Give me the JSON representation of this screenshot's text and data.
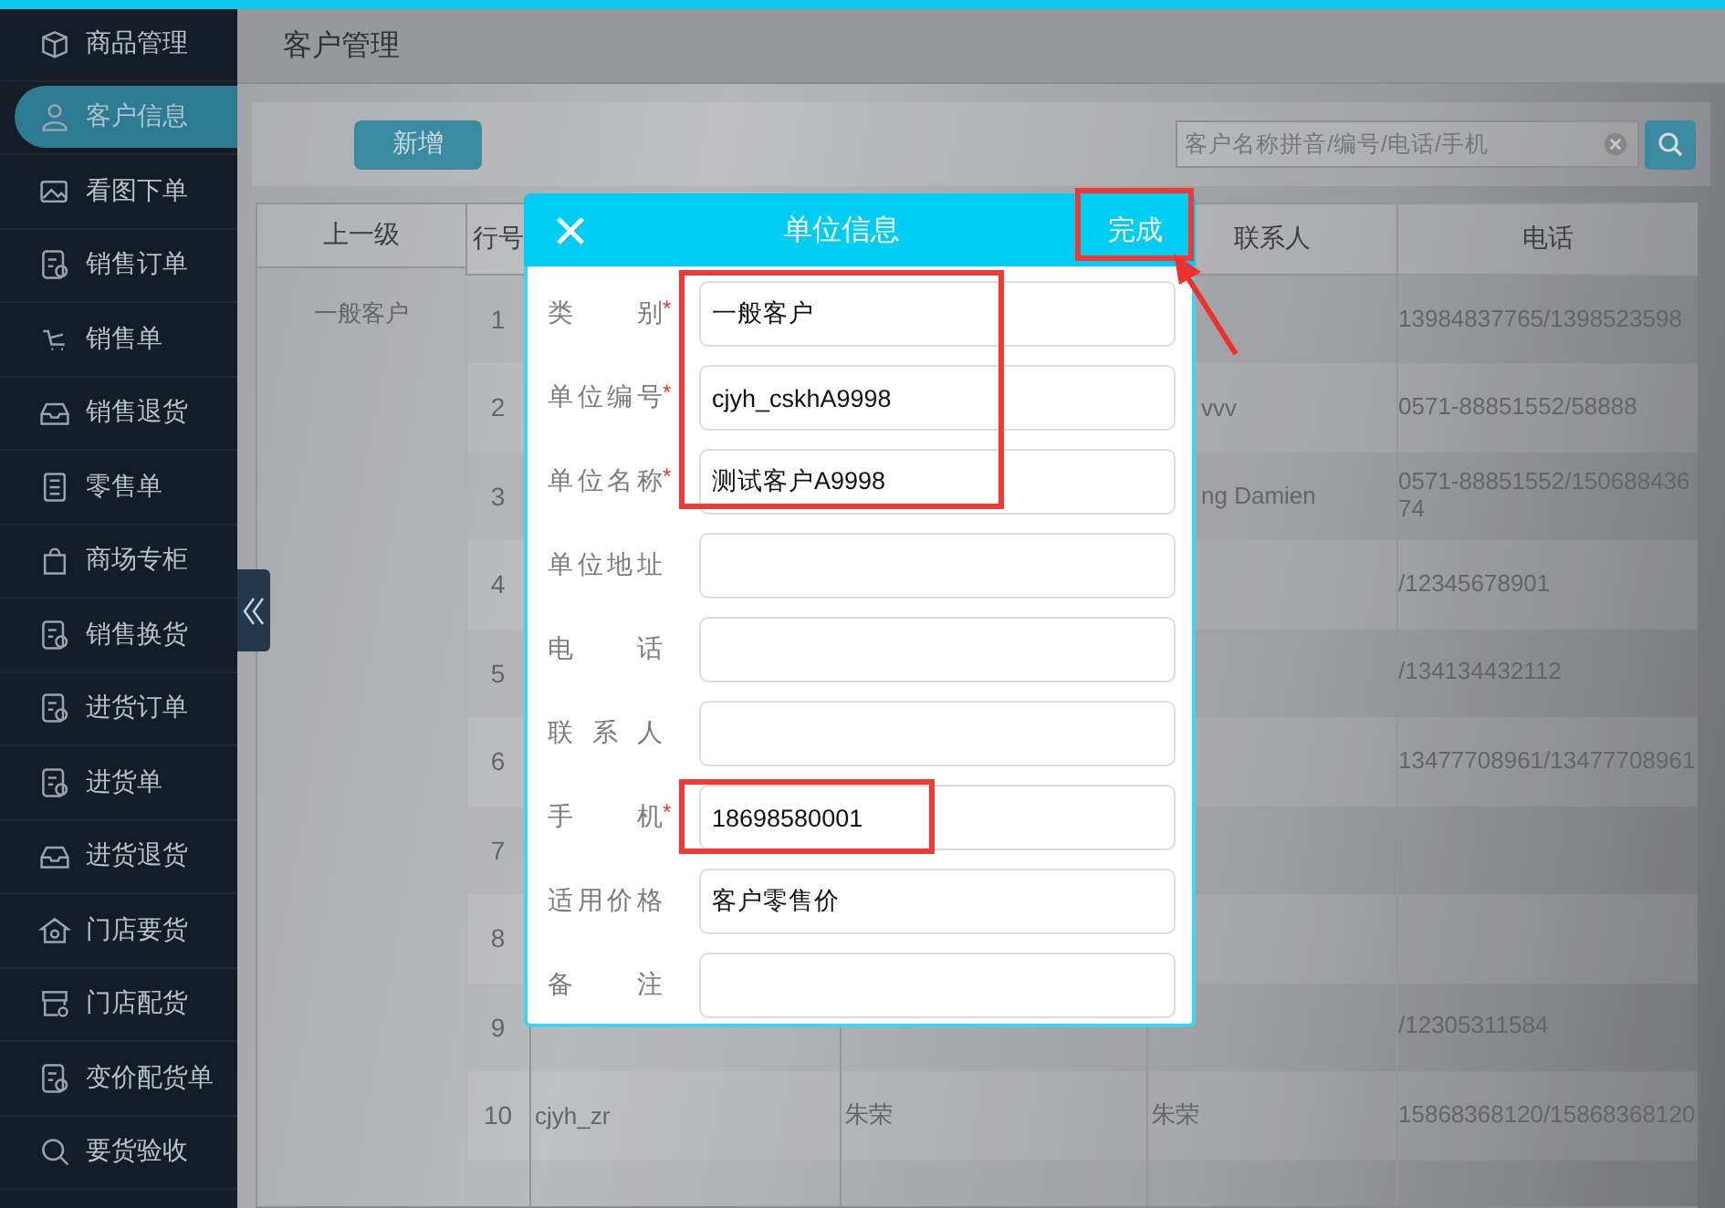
{
  "sidebar": {
    "items": [
      {
        "label": "商品管理",
        "selected": false
      },
      {
        "label": "客户信息",
        "selected": true
      },
      {
        "label": "看图下单",
        "selected": false
      },
      {
        "label": "销售订单",
        "selected": false
      },
      {
        "label": "销售单",
        "selected": false
      },
      {
        "label": "销售退货",
        "selected": false
      },
      {
        "label": "零售单",
        "selected": false
      },
      {
        "label": "商场专柜",
        "selected": false
      },
      {
        "label": "销售换货",
        "selected": false
      },
      {
        "label": "进货订单",
        "selected": false
      },
      {
        "label": "进货单",
        "selected": false
      },
      {
        "label": "进货退货",
        "selected": false
      },
      {
        "label": "门店要货",
        "selected": false
      },
      {
        "label": "门店配货",
        "selected": false
      },
      {
        "label": "变价配货单",
        "selected": false
      },
      {
        "label": "要货验收",
        "selected": false
      }
    ]
  },
  "page_title": "客户管理",
  "toolbar": {
    "add_button": "新增",
    "search": {
      "placeholder": "客户名称拼音/编号/电话/手机"
    }
  },
  "table": {
    "header": {
      "parent": "上一级",
      "row_no": "行号",
      "contact": "联系人",
      "phone": "电话"
    },
    "parent_group": "一般客户",
    "rows": [
      {
        "row_no": "1",
        "phone": "13984837765/1398523598"
      },
      {
        "row_no": "2",
        "contact": "vvv",
        "contact_partly_hidden": true,
        "phone": "0571-88851552/58888"
      },
      {
        "row_no": "3",
        "contact": "ng Damien",
        "contact_partly_hidden": true,
        "phone": "0571-88851552/15068843674"
      },
      {
        "row_no": "4",
        "phone": "/12345678901"
      },
      {
        "row_no": "5",
        "phone": "/134134432112"
      },
      {
        "row_no": "6",
        "phone": "13477708961/13477708961"
      },
      {
        "row_no": "7"
      },
      {
        "row_no": "8"
      },
      {
        "row_no": "9",
        "phone": "/12305311584"
      },
      {
        "row_no": "10",
        "column_3": "cjyh_zr",
        "column_4": "朱荣",
        "contact": "朱荣",
        "phone": "15868368120/15868368120"
      }
    ]
  },
  "dialog": {
    "title": "单位信息",
    "done_button": "完成",
    "fields": [
      {
        "label": "类别",
        "required_mark": "*",
        "value": "一般客户"
      },
      {
        "label": "单位编号",
        "required_mark": "*",
        "value": "cjyh_cskhA9998"
      },
      {
        "label": "单位名称",
        "required_mark": "*",
        "value": "测试客户A9998"
      },
      {
        "label": "单位地址"
      },
      {
        "label": "电话"
      },
      {
        "label": "联系人"
      },
      {
        "label": "手机",
        "required_mark": "*",
        "value": "18698580001"
      },
      {
        "label": "适用价格",
        "value": "客户零售价"
      },
      {
        "label": "备注"
      }
    ]
  }
}
